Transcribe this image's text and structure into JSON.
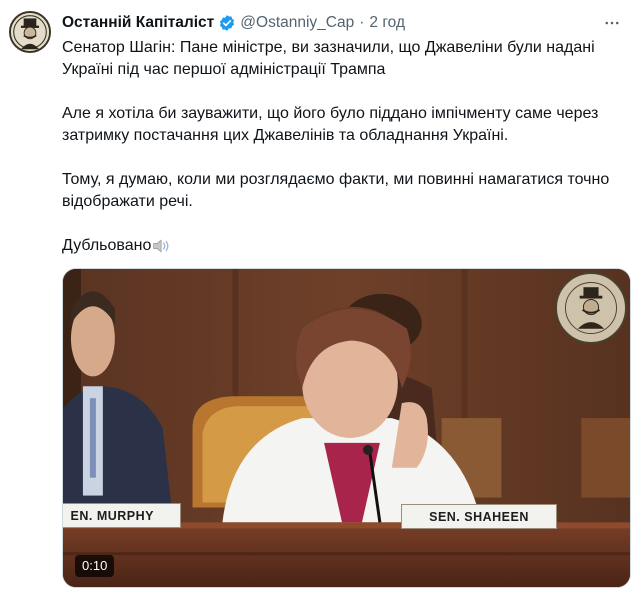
{
  "author": {
    "display_name": "Останній Капіталіст",
    "handle": "@Ostanniy_Cap",
    "separator": "·",
    "time": "2 год",
    "verified": true,
    "avatar_icon": "caricature-avatar-icon"
  },
  "tweet": {
    "paragraphs": [
      "Сенатор Шагін: Пане міністре, ви зазначили, що Джавеліни були надані Україні під час першої адміністрації Трампа",
      "Але я хотіла би зауважити, що його було піддано імпічменту саме через затримку постачання цих Джавелінів та обладнання Україні.",
      "Тому, я думаю, коли ми розглядаємо факти, ми повинні намагатися точно відображати речі."
    ],
    "dub_label": "Дубльовано",
    "dub_icon": "speaker-icon"
  },
  "video": {
    "duration": "0:10",
    "nameplate_left": "EN. MURPHY",
    "nameplate_right": "SEN. SHAHEEN",
    "watermark_icon": "ostanniy-kapitalist-badge-icon"
  },
  "colors": {
    "verified_blue": "#1d9bf0",
    "secondary_text": "#536471",
    "wood": "#6a3d24"
  }
}
